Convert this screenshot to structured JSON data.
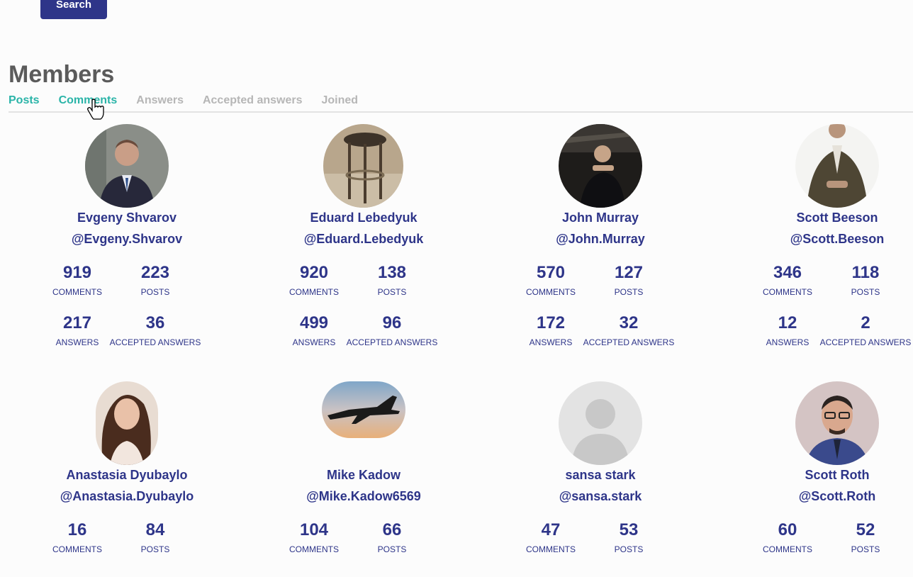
{
  "search": {
    "label": "Search"
  },
  "page": {
    "title": "Members"
  },
  "tabs": [
    {
      "label": "Posts"
    },
    {
      "label": "Comments"
    },
    {
      "label": "Answers"
    },
    {
      "label": "Accepted answers"
    },
    {
      "label": "Joined"
    }
  ],
  "stat_labels": {
    "comments": "COMMENTS",
    "posts": "POSTS",
    "answers": "ANSWERS",
    "accepted": "ACCEPTED ANSWERS"
  },
  "members": [
    {
      "name": "Evgeny Shvarov",
      "handle": "@Evgeny.Shvarov",
      "comments": "919",
      "posts": "223",
      "answers": "217",
      "accepted": "36"
    },
    {
      "name": "Eduard Lebedyuk",
      "handle": "@Eduard.Lebedyuk",
      "comments": "920",
      "posts": "138",
      "answers": "499",
      "accepted": "96"
    },
    {
      "name": "John Murray",
      "handle": "@John.Murray",
      "comments": "570",
      "posts": "127",
      "answers": "172",
      "accepted": "32"
    },
    {
      "name": "Scott Beeson",
      "handle": "@Scott.Beeson",
      "comments": "346",
      "posts": "118",
      "answers": "12",
      "accepted": "2"
    },
    {
      "name": "Anastasia Dyubaylo",
      "handle": "@Anastasia.Dyubaylo",
      "comments": "16",
      "posts": "84"
    },
    {
      "name": "Mike Kadow",
      "handle": "@Mike.Kadow6569",
      "comments": "104",
      "posts": "66"
    },
    {
      "name": "sansa stark",
      "handle": "@sansa.stark",
      "comments": "47",
      "posts": "53"
    },
    {
      "name": "Scott Roth",
      "handle": "@Scott.Roth",
      "comments": "60",
      "posts": "52"
    }
  ]
}
